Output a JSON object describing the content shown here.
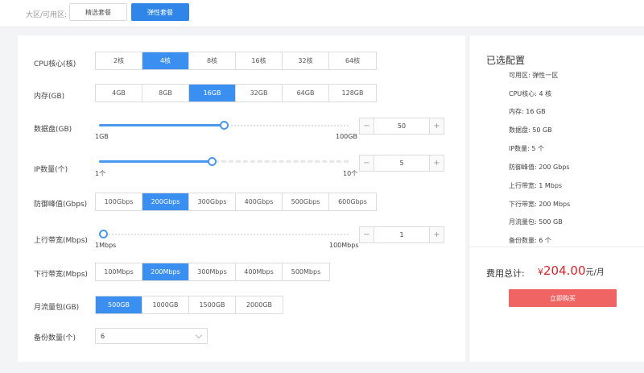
{
  "topbar": {
    "region_label": "大区/可用区:",
    "packages": [
      "精选套餐",
      "弹性套餐"
    ]
  },
  "cpu": {
    "label": "CPU核心(核)",
    "options": [
      "2核",
      "4核",
      "8核",
      "16核",
      "32核",
      "64核"
    ],
    "selected": 1
  },
  "memory": {
    "label": "内存(GB)",
    "options": [
      "4GB",
      "8GB",
      "16GB",
      "32GB",
      "64GB",
      "128GB"
    ],
    "selected": 2
  },
  "disk": {
    "label": "数据盘(GB)",
    "min_label": "1GB",
    "max_label": "100GB",
    "value": "50",
    "level": 0.5,
    "minus": "−",
    "plus": "+"
  },
  "ip": {
    "label": "IP数量(个)",
    "min_label": "1个",
    "max_label": "10个",
    "value": "5",
    "level": 0.45,
    "minus": "−",
    "plus": "+"
  },
  "defense": {
    "label": "防御峰值(Gbps)",
    "options": [
      "100Gbps",
      "200Gbps",
      "300Gbps",
      "400Gbps",
      "500Gbps",
      "600Gbps"
    ],
    "selected": 1
  },
  "upload": {
    "label": "上行带宽(Mbps)",
    "min_label": "1Mbps",
    "max_label": "100Mbps",
    "value": "1",
    "level": 0.0,
    "minus": "−",
    "plus": "+"
  },
  "download": {
    "label": "下行带宽(Mbps)",
    "options": [
      "100Mbps",
      "200Mbps",
      "300Mbps",
      "400Mbps",
      "500Mbps"
    ],
    "selected": 1
  },
  "traffic": {
    "label": "月流量包(GB)",
    "options": [
      "500GB",
      "1000GB",
      "1500GB",
      "2000GB"
    ],
    "selected": 0
  },
  "backup": {
    "label": "备份数量(个)",
    "value": "6"
  },
  "summary": {
    "title": "已选配置",
    "items": [
      "可用区:  弹性一区",
      "CPU核心:  4 核",
      "内存:  16 GB",
      "数据盘:  50 GB",
      "IP数量:  5 个",
      "防御峰值:  200 Gbps",
      "上行带宽:  1 Mbps",
      "下行带宽:  200 Mbps",
      "月流量包:  500 GB",
      "备份数量:  6 个"
    ],
    "total_label": "费用总计:",
    "currency": "¥",
    "amount": "204.00",
    "unit": "元/月",
    "buy_label": "立即购买"
  },
  "colors": {
    "primary": "#3a8ff0",
    "buy": "#f06464",
    "price": "#d9232a"
  }
}
